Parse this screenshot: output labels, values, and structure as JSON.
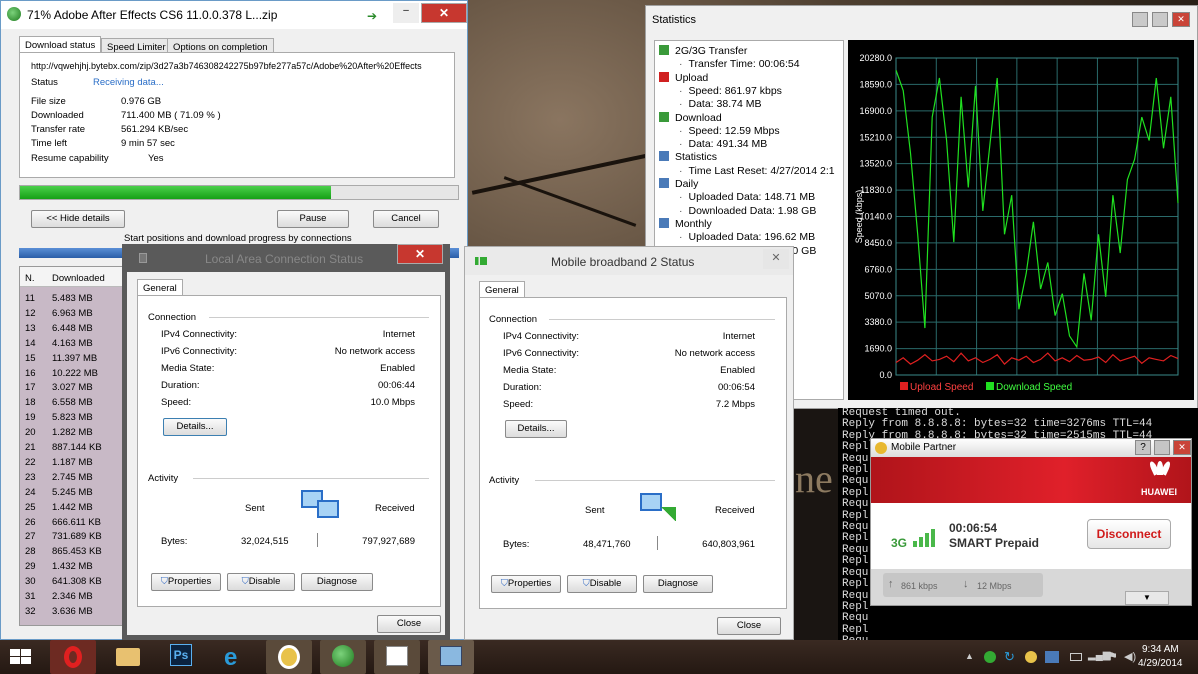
{
  "desktop": {
    "background_text": "ne"
  },
  "download": {
    "title": "71% Adobe After Effects CS6 11.0.0.378 L...zip",
    "tabs": [
      "Download status",
      "Speed Limiter",
      "Options on completion"
    ],
    "url": "http://vqwehjhj.bytebx.com/zip/3d27a3b746308242275b97bfe277a57c/Adobe%20After%20Effects",
    "status_label": "Status",
    "status_value": "Receiving data...",
    "file_size_label": "File size",
    "file_size": "0.976  GB",
    "downloaded_label": "Downloaded",
    "downloaded": "711.400  MB  ( 71.09 % )",
    "rate_label": "Transfer rate",
    "rate": "561.294  KB/sec",
    "time_left_label": "Time left",
    "time_left": "9 min 57 sec",
    "resume_label": "Resume capability",
    "resume": "Yes",
    "progress": 71.09,
    "hide_details": "<< Hide details",
    "pause": "Pause",
    "cancel": "Cancel",
    "connections_caption": "Start positions and download progress by connections",
    "col_n": "N.",
    "col_downloaded": "Downloaded",
    "rows": [
      [
        "11",
        "5.483 MB"
      ],
      [
        "12",
        "6.963 MB"
      ],
      [
        "13",
        "6.448 MB"
      ],
      [
        "14",
        "4.163 MB"
      ],
      [
        "15",
        "11.397 MB"
      ],
      [
        "16",
        "10.222 MB"
      ],
      [
        "17",
        "3.027 MB"
      ],
      [
        "18",
        "6.558 MB"
      ],
      [
        "19",
        "5.823 MB"
      ],
      [
        "20",
        "1.282 MB"
      ],
      [
        "21",
        "887.144 KB"
      ],
      [
        "22",
        "1.187 MB"
      ],
      [
        "23",
        "2.745 MB"
      ],
      [
        "24",
        "5.245 MB"
      ],
      [
        "25",
        "1.442 MB"
      ],
      [
        "26",
        "666.611 KB"
      ],
      [
        "27",
        "731.689 KB"
      ],
      [
        "28",
        "865.453 KB"
      ],
      [
        "29",
        "1.432 MB"
      ],
      [
        "30",
        "641.308 KB"
      ],
      [
        "31",
        "2.346 MB"
      ],
      [
        "32",
        "3.636 MB"
      ]
    ]
  },
  "statistics": {
    "title": "Statistics",
    "tree": [
      {
        "text": "2G/3G Transfer",
        "level": 0
      },
      {
        "text": "Transfer Time: 00:06:54",
        "level": 1
      },
      {
        "text": "Upload",
        "level": 0
      },
      {
        "text": "Speed: 861.97 kbps",
        "level": 1
      },
      {
        "text": "Data: 38.74 MB",
        "level": 1
      },
      {
        "text": "Download",
        "level": 0
      },
      {
        "text": "Speed: 12.59 Mbps",
        "level": 1
      },
      {
        "text": "Data: 491.34 MB",
        "level": 1
      },
      {
        "text": "Statistics",
        "level": 0
      },
      {
        "text": "Time Last Reset: 4/27/2014 2:1",
        "level": 1
      },
      {
        "text": "Daily",
        "level": 0
      },
      {
        "text": "Uploaded Data: 148.71 MB",
        "level": 1
      },
      {
        "text": "Downloaded Data: 1.98 GB",
        "level": 1
      },
      {
        "text": "Monthly",
        "level": 0
      },
      {
        "text": "Uploaded Data: 196.62 MB",
        "level": 1
      },
      {
        "text": "Downloaded Data: 2.30 GB",
        "level": 1
      }
    ],
    "tree_partial": [
      "96.62 MB",
      "a: 2.30 GB",
      "e accurate"
    ]
  },
  "chart_data": {
    "type": "line",
    "ylabel": "Speed (kbps)",
    "ylim": [
      0,
      20280
    ],
    "yticks": [
      "20280.0",
      "18590.0",
      "16900.0",
      "15210.0",
      "13520.0",
      "11830.0",
      "10140.0",
      "8450.0",
      "6760.0",
      "5070.0",
      "3380.0",
      "1690.0",
      "0.0"
    ],
    "series": [
      {
        "name": "Upload Speed",
        "color": "#e02020",
        "values": [
          800,
          1100,
          700,
          950,
          1300,
          900,
          1000,
          1200,
          850,
          1400,
          900,
          1100,
          800,
          1000,
          1300,
          700,
          1100,
          950,
          1200,
          800,
          1000,
          1400,
          900,
          1100,
          850,
          1250,
          950,
          1000,
          1150,
          800,
          1300,
          900,
          1050,
          1200,
          750,
          1100,
          1000,
          900,
          1250,
          1050
        ]
      },
      {
        "name": "Download Speed",
        "color": "#20e020",
        "values": [
          19500,
          18200,
          14200,
          9000,
          3000,
          16500,
          19000,
          15000,
          8500,
          17800,
          12000,
          18500,
          10500,
          14800,
          19000,
          9000,
          11500,
          4200,
          6500,
          9800,
          5500,
          7200,
          3800,
          5200,
          2500,
          1800,
          6500,
          3500,
          9000,
          5000,
          11500,
          7800,
          12500,
          13800,
          16500,
          15000,
          19000,
          14500,
          17800,
          11000
        ]
      }
    ]
  },
  "lan": {
    "title": "Local Area Connection Status",
    "tab": "General",
    "connection": "Connection",
    "ipv4_label": "IPv4 Connectivity:",
    "ipv4": "Internet",
    "ipv6_label": "IPv6 Connectivity:",
    "ipv6": "No network access",
    "media_label": "Media State:",
    "media": "Enabled",
    "duration_label": "Duration:",
    "duration": "00:06:44",
    "speed_label": "Speed:",
    "speed": "10.0 Mbps",
    "details": "Details...",
    "activity": "Activity",
    "sent_label": "Sent",
    "received_label": "Received",
    "bytes_label": "Bytes:",
    "sent": "32,024,515",
    "received": "797,927,689",
    "properties": "Properties",
    "disable": "Disable",
    "diagnose": "Diagnose",
    "close": "Close"
  },
  "mbb": {
    "title": "Mobile broadband 2 Status",
    "tab": "General",
    "connection": "Connection",
    "ipv4_label": "IPv4 Connectivity:",
    "ipv4": "Internet",
    "ipv6_label": "IPv6 Connectivity:",
    "ipv6": "No network access",
    "media_label": "Media State:",
    "media": "Enabled",
    "duration_label": "Duration:",
    "duration": "00:06:54",
    "speed_label": "Speed:",
    "speed": "7.2 Mbps",
    "details": "Details...",
    "activity": "Activity",
    "sent_label": "Sent",
    "received_label": "Received",
    "bytes_label": "Bytes:",
    "sent": "48,471,760",
    "received": "640,803,961",
    "properties": "Properties",
    "disable": "Disable",
    "diagnose": "Diagnose",
    "close": "Close"
  },
  "console": {
    "lines": [
      "Request timed out.",
      "Reply from 8.8.8.8: bytes=32 time=3276ms TTL=44",
      "Reply from 8.8.8.8: bytes=32 time=2515ms TTL=44",
      "Repl",
      "Requ",
      "Repl",
      "Requ",
      "Repl",
      "Requ",
      "Repl",
      "Requ",
      "Repl",
      "Requ",
      "Repl",
      "Requ",
      "Repl",
      "Requ",
      "Repl",
      "Requ",
      "Repl",
      "Requ",
      "Request timed out.",
      "Request timed out."
    ]
  },
  "mobile_partner": {
    "title": "Mobile Partner",
    "brand": "HUAWEI",
    "network": "3G",
    "time": "00:06:54",
    "operator": "SMART Prepaid",
    "disconnect": "Disconnect",
    "up_speed": "861 kbps",
    "down_speed": "12 Mbps"
  },
  "taskbar": {
    "time": "9:34 AM",
    "date": "4/29/2014",
    "ps_label": "Ps"
  }
}
